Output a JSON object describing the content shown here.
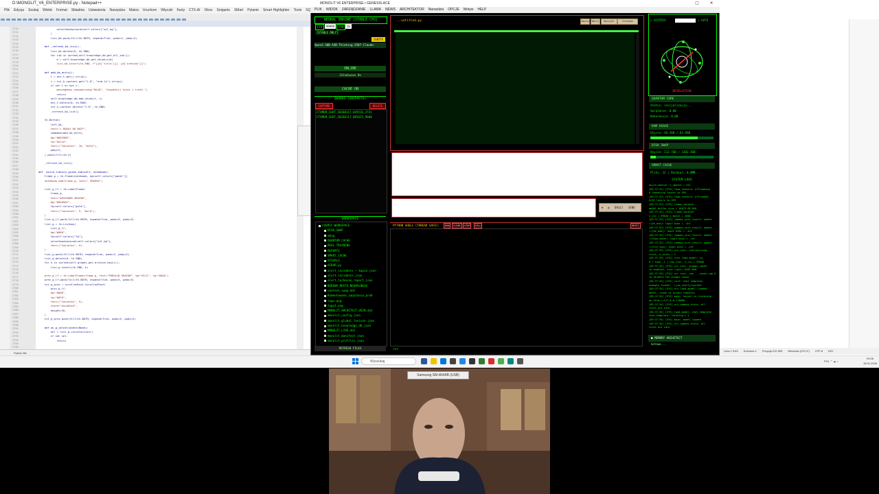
{
  "editor": {
    "title": "D:\\MONOLIT_V6_ENTERPRISE.py - Notepad++",
    "menu": [
      "Plik",
      "Edycja",
      "Szukaj",
      "Widok",
      "Format",
      "Składnia",
      "Ustawienia",
      "Narzędzia",
      "Makra",
      "Uruchom",
      "Wtyczki",
      "Karty",
      "CTX-AI",
      "Okno",
      "Snippets",
      "SMart",
      "Pytanie",
      "Smart Highlighter",
      "Tools",
      "SQL",
      "Go-Coding",
      "?"
    ],
    "tabs": [
      "monolit_ns.py",
      "monolit_v6.py",
      "tools_knowledge.py",
      "monolit_enterprise.py",
      "tools.py",
      "nowy 1",
      "monolit_core.py",
      "tools_sql.py"
    ],
    "status": "Python file",
    "line_numbers": [
      "2710",
      "2711",
      "2712",
      "2713",
      "2714",
      "2715",
      "2716",
      "2717",
      "2718",
      "2719",
      "2720",
      "2721",
      "2722",
      "2723",
      "2724",
      "2725",
      "2726",
      "2727",
      "2728",
      "2729",
      "2730",
      "2731",
      "2732",
      "2733",
      "2734",
      "2735",
      "2736",
      "2737",
      "2738",
      "2739",
      "2740",
      "2741",
      "2742",
      "2743",
      "2744",
      "2745",
      "2746",
      "2747",
      "2748",
      "2749",
      "2750",
      "2751",
      "2752",
      "2753",
      "2754",
      "2755",
      "2756",
      "2757",
      "2758",
      "2759",
      "2760",
      "2761",
      "2762",
      "2763",
      "2764",
      "2765",
      "2766",
      "2767",
      "2768",
      "2769",
      "2770",
      "2771",
      "2772",
      "2773",
      "2774",
      "2775",
      "2776",
      "2777",
      "2778",
      "2779",
      "2780",
      "2781",
      "2782",
      "2783",
      "2784",
      "2785",
      "2786",
      "2787",
      "2788",
      "2789",
      "2790",
      "2791",
      "2792",
      "2793",
      "2794",
      "2795",
      "2796",
      "2797"
    ],
    "code_lines": [
      {
        "indent": 12,
        "text": "selectbackground=self.colors[\"sel_bg\"],",
        "cls": "cl"
      },
      {
        "indent": 8,
        "text": ")",
        "cls": "cl"
      },
      {
        "indent": 8,
        "text": "list_kb.pack(fill=tk.BOTH, expand=True, padx=2, pady=2)",
        "cls": "cl"
      },
      {
        "indent": 0,
        "text": "",
        "cls": "cl"
      },
      {
        "indent": 4,
        "text": "def _refresh_kb_list():",
        "cls": "cl kw"
      },
      {
        "indent": 8,
        "text": "list_kb.delete(0, tk.END)",
        "cls": "cl"
      },
      {
        "indent": 8,
        "text": "for cid in sorted(self.knowledge_db.get_all_ids()):",
        "cls": "cl"
      },
      {
        "indent": 12,
        "text": "d = self.knowledge_db.get_chunk(cid)",
        "cls": "cl"
      },
      {
        "indent": 12,
        "text": "list_kb.insert(tk.END, f\"[{d['title']}] :{d['preview']}\")",
        "cls": "cl str"
      },
      {
        "indent": 0,
        "text": "",
        "cls": "cl"
      },
      {
        "indent": 4,
        "text": "def add_kb_entry():",
        "cls": "cl kw"
      },
      {
        "indent": 8,
        "text": "t = ent_t.get().strip()",
        "cls": "cl"
      },
      {
        "indent": 8,
        "text": "c = txt_k_content.get(\"1.0\", \"end-1c\").strip()",
        "cls": "cl"
      },
      {
        "indent": 8,
        "text": "if not t or not c:",
        "cls": "cl"
      },
      {
        "indent": 12,
        "text": "messagebox.showwarning(\"BŁĄD\", \"Uzupełnij tytuł i treść.\")",
        "cls": "cl str"
      },
      {
        "indent": 12,
        "text": "return",
        "cls": "cl"
      },
      {
        "indent": 8,
        "text": "self.knowledge_db.add_chunk(t, c)",
        "cls": "cl"
      },
      {
        "indent": 8,
        "text": "ent_t.delete(0, tk.END)",
        "cls": "cl"
      },
      {
        "indent": 8,
        "text": "txt_k_content.delete(\"1.0\", tk.END)",
        "cls": "cl"
      },
      {
        "indent": 8,
        "text": "_refresh_kb_list()",
        "cls": "cl"
      },
      {
        "indent": 0,
        "text": "",
        "cls": "cl"
      },
      {
        "indent": 4,
        "text": "tk.Button(",
        "cls": "cl"
      },
      {
        "indent": 8,
        "text": "left_kb,",
        "cls": "cl"
      },
      {
        "indent": 8,
        "text": "text=\"+ DODAJ DO BAZY\",",
        "cls": "cl str"
      },
      {
        "indent": 8,
        "text": "command=add_kb_entry,",
        "cls": "cl"
      },
      {
        "indent": 8,
        "text": "bg=\"#003300\",",
        "cls": "cl str"
      },
      {
        "indent": 8,
        "text": "fg=\"white\",",
        "cls": "cl str"
      },
      {
        "indent": 8,
        "text": "font=(\"Consolas\", 10, \"bold\"),",
        "cls": "cl str"
      },
      {
        "indent": 8,
        "text": "pady=5,",
        "cls": "cl"
      },
      {
        "indent": 4,
        "text": ").pack(fill=tk.X)",
        "cls": "cl"
      },
      {
        "indent": 0,
        "text": "",
        "cls": "cl"
      },
      {
        "indent": 4,
        "text": "_refresh_kb_list()",
        "cls": "cl"
      },
      {
        "indent": 0,
        "text": "",
        "cls": "cl"
      },
      {
        "indent": 0,
        "text": "def _build_library_guide_tab(self, notebook):",
        "cls": "cl kw"
      },
      {
        "indent": 4,
        "text": "frame_g = tk.Frame(notebook, bg=self.colors[\"panel\"])",
        "cls": "cl"
      },
      {
        "indent": 4,
        "text": "notebook.add(frame_g, text=\" GRAPHS\")",
        "cls": "cl str"
      },
      {
        "indent": 0,
        "text": "",
        "cls": "cl"
      },
      {
        "indent": 4,
        "text": "list_g_lf = tk.LabelFrame(",
        "cls": "cl"
      },
      {
        "indent": 8,
        "text": "frame_g,",
        "cls": "cl"
      },
      {
        "indent": 8,
        "text": "text=\"ARCHIWUM GRAFÓW\",",
        "cls": "cl str"
      },
      {
        "indent": 8,
        "text": "bg=\"#050505\",",
        "cls": "cl str"
      },
      {
        "indent": 8,
        "text": "fg=self.colors[\"gold\"],",
        "cls": "cl"
      },
      {
        "indent": 8,
        "text": "font=(\"Consolas\", 9, \"bold\"),",
        "cls": "cl str"
      },
      {
        "indent": 4,
        "text": ")",
        "cls": "cl"
      },
      {
        "indent": 4,
        "text": "list_g_lf.pack(fill=tk.BOTH, expand=True, padx=5, pady=5)",
        "cls": "cl"
      },
      {
        "indent": 4,
        "text": "list_g = tk.Listbox(",
        "cls": "cl"
      },
      {
        "indent": 8,
        "text": "list_g_lf,",
        "cls": "cl"
      },
      {
        "indent": 8,
        "text": "bg=\"#000\",",
        "cls": "cl str"
      },
      {
        "indent": 8,
        "text": "fg=self.colors[\"fg\"],",
        "cls": "cl"
      },
      {
        "indent": 8,
        "text": "selectbackground=self.colors[\"sel_bg\"],",
        "cls": "cl"
      },
      {
        "indent": 8,
        "text": "font=(\"Consolas\", 9),",
        "cls": "cl str"
      },
      {
        "indent": 4,
        "text": ")",
        "cls": "cl"
      },
      {
        "indent": 4,
        "text": "list_g.pack(fill=tk.BOTH, expand=True, padx=2, pady=2)",
        "cls": "cl"
      },
      {
        "indent": 4,
        "text": "list_g.delete(0, tk.END)",
        "cls": "cl"
      },
      {
        "indent": 4,
        "text": "for k in sorted(self.graphs.get_archive_keys()):",
        "cls": "cl"
      },
      {
        "indent": 8,
        "text": "list_g.insert(tk.END, k)",
        "cls": "cl"
      },
      {
        "indent": 0,
        "text": "",
        "cls": "cl"
      },
      {
        "indent": 4,
        "text": "prev_g_lf = tk.LabelFrame(frame_g, text=\"PODGLĄD GRAFÓW\", bg=\"#111\", fg=\"#AAA\")",
        "cls": "cl str"
      },
      {
        "indent": 4,
        "text": "prev_g_lf.pack(fill=tk.BOTH, expand=True, padx=5, pady=5)",
        "cls": "cl"
      },
      {
        "indent": 4,
        "text": "txt_g_prev = scrolledtext.ScrolledText(",
        "cls": "cl"
      },
      {
        "indent": 8,
        "text": "prev_g_lf,",
        "cls": "cl"
      },
      {
        "indent": 8,
        "text": "bg=\"#000\",",
        "cls": "cl str"
      },
      {
        "indent": 8,
        "text": "fg=\"#0F0\",",
        "cls": "cl str"
      },
      {
        "indent": 8,
        "text": "font=(\"Consolas\", 9),",
        "cls": "cl str"
      },
      {
        "indent": 8,
        "text": "state=\"disabled\",",
        "cls": "cl str"
      },
      {
        "indent": 8,
        "text": "height=10,",
        "cls": "cl"
      },
      {
        "indent": 4,
        "text": ")",
        "cls": "cl"
      },
      {
        "indent": 4,
        "text": "txt_g_prev.pack(fill=tk.BOTH, expand=True, padx=5, pady=5)",
        "cls": "cl"
      },
      {
        "indent": 0,
        "text": "",
        "cls": "cl"
      },
      {
        "indent": 4,
        "text": "def on_g_select(event=None):",
        "cls": "cl kw"
      },
      {
        "indent": 8,
        "text": "sel = list_g.curselection()",
        "cls": "cl"
      },
      {
        "indent": 8,
        "text": "if not sel:",
        "cls": "cl"
      },
      {
        "indent": 12,
        "text": "return",
        "cls": "cl"
      }
    ]
  },
  "bgapp": {
    "status_items": [
      "Linia 1 9/40",
      "Kolumna 1",
      "Pozycja 210 963",
      "Windows (CR LF)",
      "UTF-8",
      "INS"
    ]
  },
  "monolit": {
    "title": "MONOLIT V6 ENTERPRISE • GENESIS.ACE",
    "menu": [
      "PLIK",
      "WIDOK",
      "ZARZĄDZANIE",
      "LLAMA",
      "NEWS",
      "ARCHITEKTOR",
      "Narzędzia",
      "OPCJE",
      "Motyw",
      "HELP"
    ],
    "neural_header": "NEURAL ENGINE [STABLE-CPU]",
    "ctx_label": "CTX",
    "ctx_value": "99999",
    "cpu_label": "CPU",
    "cpu_value": "16",
    "stable_only": "[STABLE ONLY]",
    "ignite": "IGNITE",
    "model_name": "Qwen3-30B-A3B-Thinking-2507-Claude-",
    "online": "ONLINE",
    "load_status": "Załadowano 0%",
    "cache": "CACHE ON",
    "quarks_header": "QUARKS (SNIPPETS)",
    "capture": "CAPTURE",
    "delete": "DELETE",
    "quarks": [
      "CTXMEM_CHAT_20260117_045516_2721",
      "CTXMEM_CHAT_20260117_065625_9600"
    ],
    "workspace_header": "WORKSPACE",
    "workspace_tree": [
      {
        "depth": 0,
        "label": "COSMIC_WORKSPACE"
      },
      {
        "depth": 1,
        "label": "DISK_SWAP"
      },
      {
        "depth": 1,
        "label": "mózg"
      },
      {
        "depth": 1,
        "label": "QUANTUM_CACHE"
      },
      {
        "depth": 1,
        "label": "REAL_TRAINING"
      },
      {
        "depth": 1,
        "label": "REPORTS"
      },
      {
        "depth": 1,
        "label": "SMART_CACHE"
      },
      {
        "depth": 1,
        "label": "VISUALS"
      },
      {
        "depth": 1,
        "label": "AIBOR.py"
      },
      {
        "depth": 1,
        "label": "alert_incidents — kopia.json"
      },
      {
        "depth": 1,
        "label": "alert_incidents.json"
      },
      {
        "depth": 1,
        "label": "alert_turbocan_report.json"
      },
      {
        "depth": 1,
        "label": "BUDOWA_MOSTU_NEURALNEGO"
      },
      {
        "depth": 1,
        "label": "context_swap.dat"
      },
      {
        "depth": 1,
        "label": "Komentowane_zapytania_prob"
      },
      {
        "depth": 1,
        "label": "logo.png"
      },
      {
        "depth": 1,
        "label": "logo1.png"
      },
      {
        "depth": 1,
        "label": "MONOLIT_ARCHITECT_VEIN.dat"
      },
      {
        "depth": 1,
        "label": "monolit_config.json"
      },
      {
        "depth": 1,
        "label": "monolit_global_lexicon.json"
      },
      {
        "depth": 1,
        "label": "monolit_knowledge_db.json"
      },
      {
        "depth": 1,
        "label": "MONOLIT_LIVE.dat"
      },
      {
        "depth": 1,
        "label": "monolit_manifest.json"
      },
      {
        "depth": 1,
        "label": "monolit_profiles.json"
      }
    ],
    "refresh_files": "REFRESH FILES",
    "file_label": "...untitled.py",
    "top_buttons": [
      "Zapisz",
      "Wklej",
      "Wyczyść",
      "Kopiuj",
      "Uruchom"
    ],
    "send_buttons": [
      "DALEJ",
      "SEND"
    ],
    "shell_header": "PYTHON SHELL [THREAD SAFE]:",
    "shell_buttons": [
      "RUN",
      "CLEAR",
      "STOP",
      "KILL"
    ],
    "shell_end": "RESET",
    "shell_prompt": ">>>",
    "actrix": "ACXTRIX",
    "auto": "AUTO",
    "revelation": "REVELATION",
    "quantum_header": "QUANTUM CORE",
    "quantum_lines": [
      "Status: inicjalizacja...",
      "Splątanie: 0.00",
      "Koherencja: 0.00"
    ],
    "ram_header": "RAM USAGE",
    "ram_line": "Użycie: 46.3GB / 61.9GB",
    "ram_fraction": 0.75,
    "swap_header": "DISK SWAP",
    "swap_line": "Użycie: 112.7GB / 1302.3GB",
    "swap_fraction": 0.09,
    "smart_header": "SMART CACHE",
    "smart_line": "Pliki: 12 | Rozmiar: 0.0MB",
    "logs_header": "SYSTEM LOGS",
    "logs": [
      "build_ubatch: n_ubatch = 512",
      "[05:37:31] [SYS] load_tensors: offloading",
      "  0 repeating layers to GPU",
      "[05:37:31] [SYS] load_tensors: offloaded",
      "  0/49 layers to GPU",
      "[05:37:31] [SYS] llama_context:",
      "  model buffer size = 16075.68 MiB",
      "[05:37:32] [SYS] llama_context:",
      "  n_ctx = 99840 n_batch = 2048",
      "[05:37:32] [SYS] common_init_result: added",
      "  <|im_end|> logit bias = -inf",
      "[05:37:32] [SYS] common_init_result: added",
      "  <|fim_pad|> logit bias = -inf",
      "[05:37:32] [SYS] common_init_result: added",
      "  <|repo_name|> logit bias = -inf",
      "[05:37:32] [SYS] common_init_result: added",
      "  <|file_sep|> logit bias = -inf",
      "[05:37:33] [SYS] srv  init: initializing",
      "  slots, n_slots = 1",
      "[05:37:33] [SYS] slot  load_model: id",
      "  0 | task -1 | new slot, n_ctx = 99840",
      "[05:37:33] [SYS] srv  init: prompt cache",
      "  is enabled, size limit: 8192 MiB",
      "[05:37:33] [SYS] srv  init: use `--cache-ram 0`",
      "  to disable the prompt cache",
      "[05:37:33] [SYS] init: chat template,",
      "  example_format: '<|im_start|>system'",
      "[05:37:34] [SYS] srv  load_model: loaded",
      "  model, ready to accept requests",
      "[05:37:34] [SYS] main: server is listening",
      "  on http://127.0.0.1:8080",
      "[05:37:34] [SYS] srv  update_slots: all",
      "  slots are idle",
      "[05:37:35] [SYS] load_model: chat template",
      "  chat_template: thinking = 1",
      "[05:37:35] [SYS] main: model loaded",
      "[05:37:35] [SYS] srv  update_slots: all",
      "  slots are idle"
    ],
    "memory_architect": "MEMORY ARCHITECT",
    "memory_sub": "Gotowe..."
  },
  "taskbar": {
    "search_placeholder": "Wyszukaj",
    "time": "09:08",
    "date": "18.01.2026",
    "tray": "POL"
  },
  "webcam": {
    "label": "Samsung SM-A546B (USB)"
  },
  "colors": {
    "terminal_green": "#00ff00",
    "accent_red": "#cc3333",
    "ignite_yellow": "#ffcc00"
  }
}
